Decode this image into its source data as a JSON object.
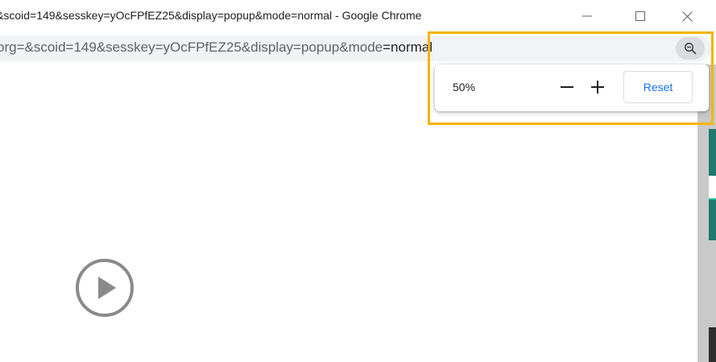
{
  "window": {
    "title": "&scoid=149&sesskey=yOcFPfEZ25&display=popup&mode=normal - Google Chrome",
    "minimize_icon": "minimize-icon",
    "maximize_icon": "maximize-icon",
    "close_icon": "close-icon"
  },
  "address_bar": {
    "url_prefix": "org=&scoid=149&sesskey=yOcFPfEZ25&display=popup&mode",
    "url_suffix": "=normal",
    "zoom_icon": "zoom-out-magnifier-icon"
  },
  "zoom_popup": {
    "level": "50%",
    "decrease_icon": "minus-icon",
    "increase_icon": "plus-icon",
    "reset_label": "Reset"
  },
  "player": {
    "play_icon": "play-circle-icon"
  },
  "colors": {
    "highlight": "#f5b400",
    "reset_text": "#1a73e8",
    "teal_accent": "#1f7a6b"
  }
}
